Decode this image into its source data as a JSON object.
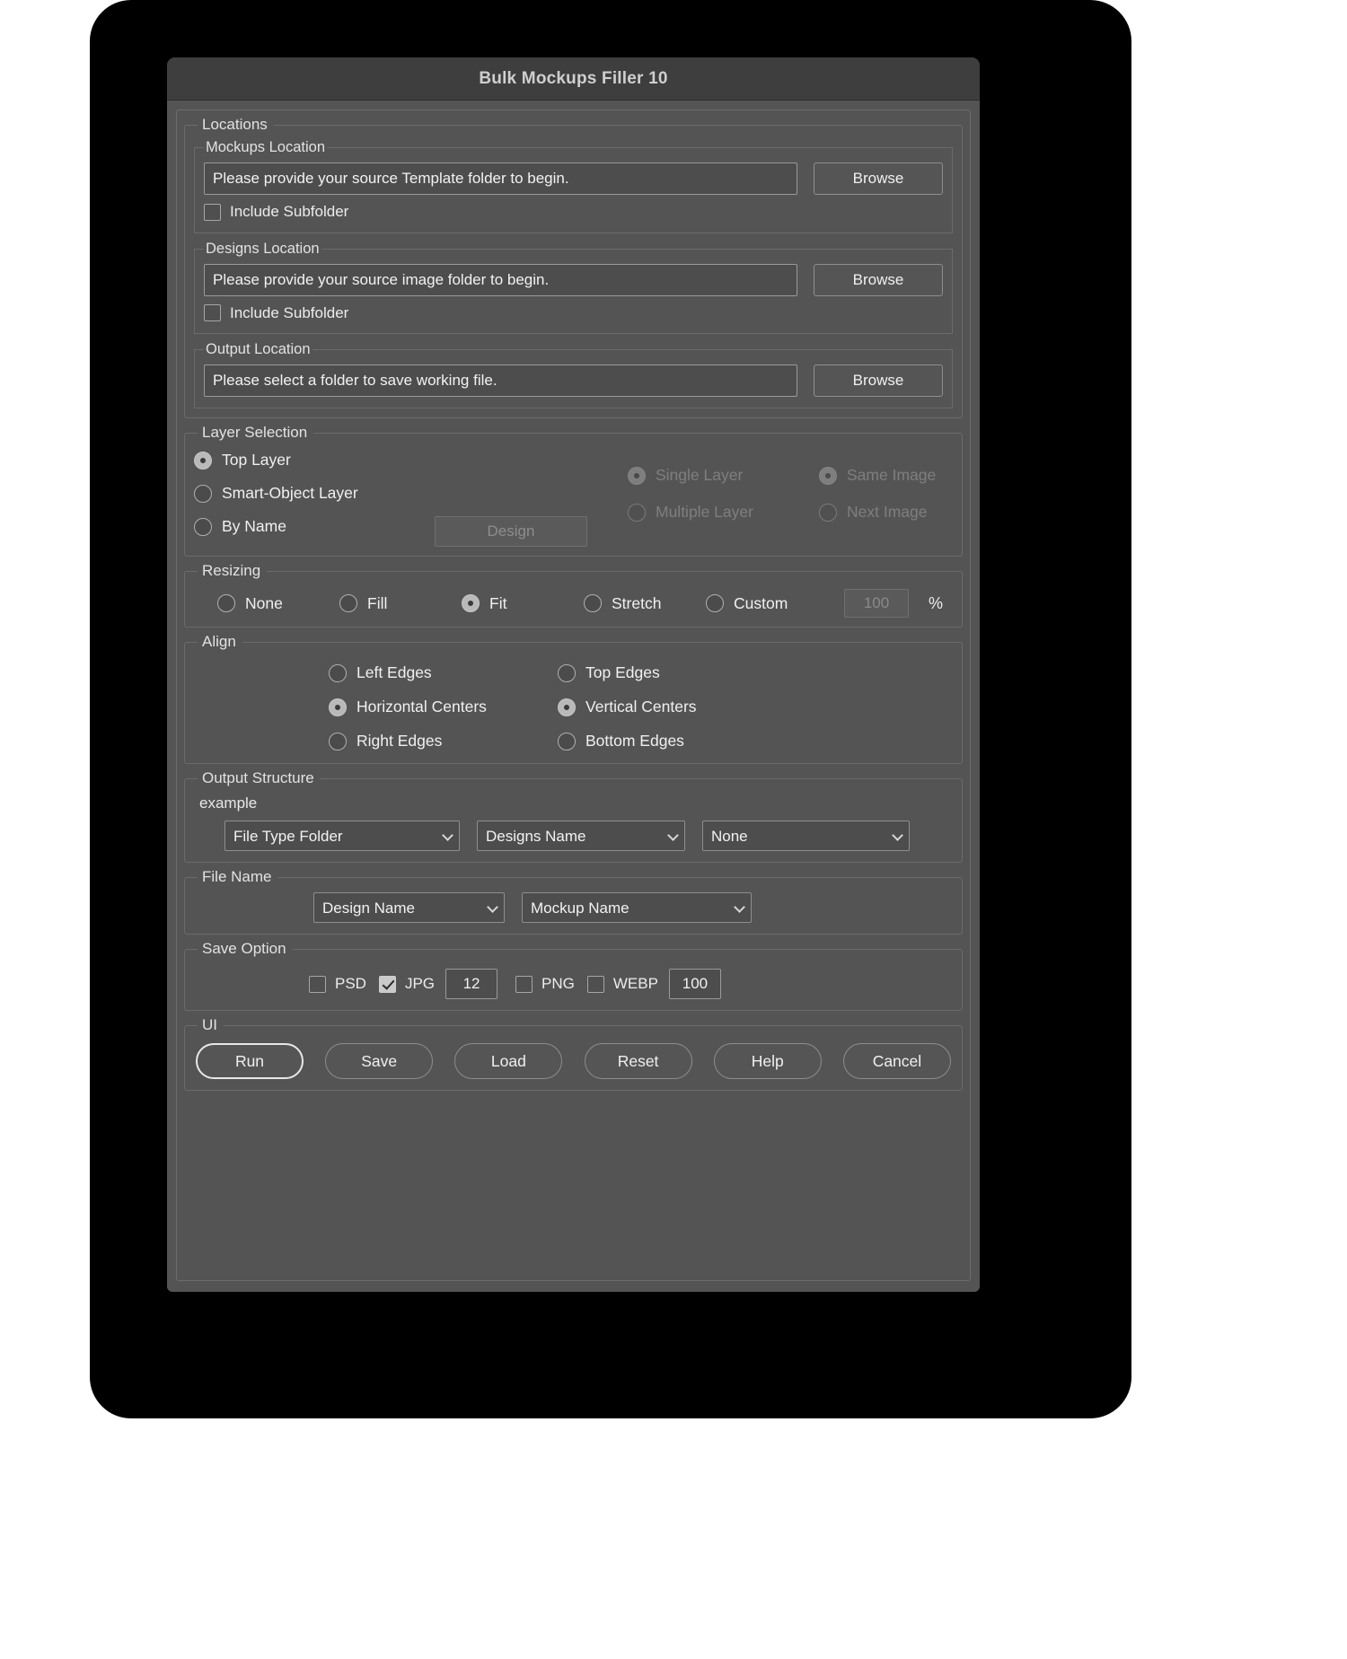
{
  "window": {
    "title": "Bulk Mockups Filler 10"
  },
  "locations": {
    "legend": "Locations",
    "mockups": {
      "legend": "Mockups Location",
      "path_value": "Please provide your source Template folder to begin.",
      "browse_label": "Browse",
      "subfolder_label": "Include Subfolder",
      "subfolder_checked": false
    },
    "designs": {
      "legend": "Designs Location",
      "path_value": "Please provide your source image folder to begin.",
      "browse_label": "Browse",
      "subfolder_label": "Include Subfolder",
      "subfolder_checked": false
    },
    "output": {
      "legend": "Output Location",
      "path_value": "Please select a folder to save working file.",
      "browse_label": "Browse"
    }
  },
  "layer_selection": {
    "legend": "Layer Selection",
    "top_layer": "Top Layer",
    "smart_object_layer": "Smart-Object Layer",
    "by_name": "By Name",
    "name_field_value": "Design",
    "single_layer": "Single Layer",
    "multiple_layer": "Multiple Layer",
    "same_image": "Same Image",
    "next_image": "Next Image"
  },
  "resizing": {
    "legend": "Resizing",
    "none": "None",
    "fill": "Fill",
    "fit": "Fit",
    "stretch": "Stretch",
    "custom": "Custom",
    "percent_value": "100",
    "percent_sign": "%"
  },
  "align": {
    "legend": "Align",
    "left_edges": "Left Edges",
    "top_edges": "Top Edges",
    "horizontal_centers": "Horizontal Centers",
    "vertical_centers": "Vertical Centers",
    "right_edges": "Right Edges",
    "bottom_edges": "Bottom Edges"
  },
  "output_structure": {
    "legend": "Output Structure",
    "example_label": "example",
    "select1": "File Type Folder",
    "select2": "Designs Name",
    "select3": "None"
  },
  "file_name": {
    "legend": "File Name",
    "select1": "Design Name",
    "select2": "Mockup Name"
  },
  "save_option": {
    "legend": "Save Option",
    "psd": "PSD",
    "psd_checked": false,
    "jpg": "JPG",
    "jpg_checked": true,
    "jpg_quality": "12",
    "png": "PNG",
    "png_checked": false,
    "webp": "WEBP",
    "webp_checked": false,
    "webp_quality": "100"
  },
  "ui": {
    "legend": "UI",
    "run": "Run",
    "save": "Save",
    "load": "Load",
    "reset": "Reset",
    "help": "Help",
    "cancel": "Cancel"
  }
}
